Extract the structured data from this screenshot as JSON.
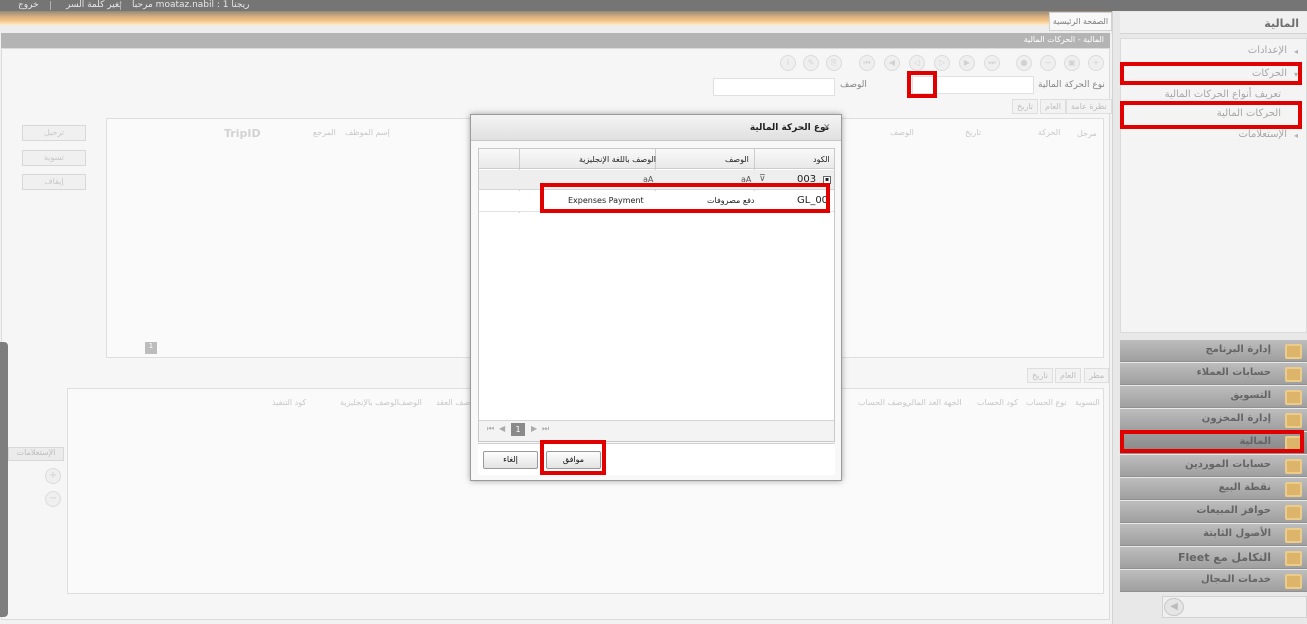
{
  "topbar": {
    "logout": "خروج",
    "change_password": "تغير كلمة السر",
    "welcome": "مرحبا moataz.nabil : ريجنا 1"
  },
  "tabs": {
    "home": "الصفحة الرئيسية"
  },
  "breadcrumb": "المالية - الحركات المالية",
  "right_panel": {
    "title": "المالية",
    "tree": [
      {
        "label": "الإعدادات"
      },
      {
        "label": "الحركات"
      },
      {
        "label": "تعريف أنواع الحركات المالية"
      },
      {
        "label": "الحركات المالية"
      },
      {
        "label": "الإستعلامات"
      }
    ],
    "modules": [
      {
        "label": "إدارة البرنامج"
      },
      {
        "label": "حسابات العملاء"
      },
      {
        "label": "التسويق"
      },
      {
        "label": "إدارة المخزون"
      },
      {
        "label": "المالية"
      },
      {
        "label": "حسابات الموردين"
      },
      {
        "label": "نقطة البيع"
      },
      {
        "label": "حوافز المبيعات"
      },
      {
        "label": "الأصول الثابتة"
      },
      {
        "label": "التكامل مع Fleet"
      },
      {
        "label": "خدمات المجال"
      }
    ]
  },
  "form": {
    "movement_type_label": "نوع الحركة المالية",
    "description_label": "الوصف",
    "tab_general": "نظرة عامة",
    "tab_year": "العام",
    "tab_date": "تاريخ",
    "tab2_month": "مطر",
    "tab2_year": "العام",
    "tab2_date": "تاريخ"
  },
  "side_buttons": {
    "post": "ترحيل",
    "settle": "تسوية",
    "stop": "إيقاف"
  },
  "grid1_headers": [
    "مرحل",
    "الحركة",
    "تاريخ",
    "الوصف",
    "إسم الموظف",
    "المرجع",
    "TripID"
  ],
  "grid2_headers": [
    "التسوية",
    "نوع الحساب",
    "كود الحساب",
    "الجهة العد المالي",
    "وصف الحساب",
    "وصف العقد",
    "الوصف",
    "الوصف بالإنجليزية",
    "كود التنفيذ"
  ],
  "queries_label": "الإستعلامات",
  "dialog": {
    "title": "نوع الحركة المالية",
    "columns": {
      "code": "الكود",
      "description": "الوصف",
      "description_en": "الوصف باللغة الإنجليزية"
    },
    "filter": {
      "code": "003",
      "description": "aA",
      "description_en": "aA"
    },
    "rows": [
      {
        "code": "GL_00",
        "description": "دفع مصروفات",
        "description_en": "Expenses Payment"
      }
    ],
    "pager": {
      "page": "1"
    },
    "ok": "موافق",
    "cancel": "إلغاء"
  }
}
